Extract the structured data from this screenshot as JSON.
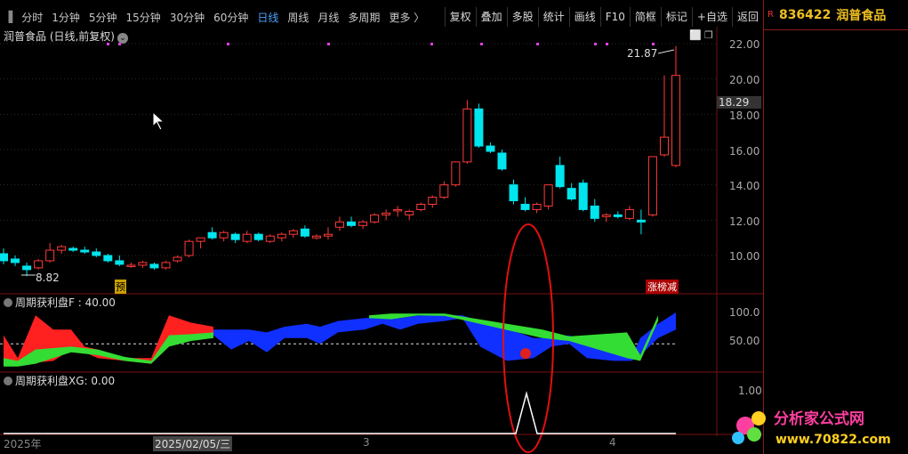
{
  "toolbar": {
    "periods": [
      "分时",
      "1分钟",
      "5分钟",
      "15分钟",
      "30分钟",
      "60分钟",
      "日线",
      "周线",
      "月线",
      "多周期",
      "更多 〉"
    ],
    "active_period": "日线",
    "buttons": [
      "复权",
      "叠加",
      "多股",
      "统计",
      "画线",
      "F10",
      "简框",
      "标记",
      "+自选",
      "返回"
    ]
  },
  "stock": {
    "title": "润普食品 (日线,前复权)",
    "code": "836422",
    "name": "润普食品"
  },
  "price_axis": [
    "22.00",
    "20.00",
    "18.00",
    "16.00",
    "14.00",
    "12.00",
    "10.00"
  ],
  "price_cursor": "18.29",
  "annotations": {
    "high": "21.87",
    "low": "8.82",
    "pre_tag": "预",
    "limit_tag": "涨榜减"
  },
  "indicator1": {
    "label": "周期获利盘F : 40.00",
    "axis": [
      "100.0",
      "50.00"
    ]
  },
  "indicator2": {
    "label": "周期获利盘XG: 0.00",
    "axis": [
      "1.00"
    ]
  },
  "time_axis": [
    "2025年",
    "2025/02/05/三",
    "3",
    "4"
  ],
  "colors": {
    "up": "#ff3a3a",
    "down": "#00e5ee",
    "red": "#ff2020",
    "green": "#33dd33",
    "blue": "#1030ff"
  },
  "chart_data": {
    "type": "candlestick",
    "ylim": [
      8,
      22.6
    ],
    "candles": [
      [
        10.1,
        10.4,
        9.5,
        9.7
      ],
      [
        9.8,
        10.0,
        9.4,
        9.6
      ],
      [
        9.4,
        9.6,
        8.82,
        9.2
      ],
      [
        9.3,
        9.8,
        9.2,
        9.7
      ],
      [
        9.7,
        10.7,
        9.6,
        10.3
      ],
      [
        10.3,
        10.6,
        10.1,
        10.5
      ],
      [
        10.4,
        10.5,
        10.2,
        10.3
      ],
      [
        10.3,
        10.5,
        10.1,
        10.2
      ],
      [
        10.2,
        10.4,
        9.9,
        10.0
      ],
      [
        10.0,
        10.1,
        9.6,
        9.7
      ],
      [
        9.7,
        10.0,
        9.4,
        9.5
      ],
      [
        9.4,
        9.6,
        9.3,
        9.45
      ],
      [
        9.45,
        9.7,
        9.3,
        9.6
      ],
      [
        9.5,
        9.6,
        9.2,
        9.3
      ],
      [
        9.3,
        9.7,
        9.2,
        9.6
      ],
      [
        9.7,
        10.0,
        9.6,
        9.9
      ],
      [
        10.0,
        10.9,
        9.9,
        10.8
      ],
      [
        10.8,
        11.0,
        10.4,
        11.0
      ],
      [
        11.3,
        11.6,
        10.9,
        11.0
      ],
      [
        11.0,
        11.4,
        10.8,
        11.3
      ],
      [
        11.2,
        11.3,
        10.7,
        10.9
      ],
      [
        10.8,
        11.4,
        10.7,
        11.2
      ],
      [
        11.2,
        11.3,
        10.8,
        10.9
      ],
      [
        10.8,
        11.2,
        10.7,
        11.1
      ],
      [
        11.0,
        11.3,
        10.8,
        11.2
      ],
      [
        11.2,
        11.5,
        11.0,
        11.4
      ],
      [
        11.5,
        11.7,
        11.0,
        11.1
      ],
      [
        11.0,
        11.2,
        10.9,
        11.1
      ],
      [
        11.1,
        11.6,
        10.9,
        11.2
      ],
      [
        11.6,
        12.2,
        11.4,
        11.9
      ],
      [
        11.9,
        12.2,
        11.6,
        11.7
      ],
      [
        11.7,
        12.0,
        11.5,
        11.9
      ],
      [
        11.9,
        12.4,
        11.8,
        12.3
      ],
      [
        12.3,
        12.6,
        12.0,
        12.4
      ],
      [
        12.6,
        12.8,
        12.2,
        12.6
      ],
      [
        12.3,
        12.6,
        12.0,
        12.5
      ],
      [
        12.6,
        13.0,
        12.5,
        12.9
      ],
      [
        12.9,
        13.4,
        12.7,
        13.3
      ],
      [
        13.3,
        14.2,
        13.2,
        14.0
      ],
      [
        14.0,
        15.2,
        13.9,
        15.3
      ],
      [
        15.3,
        18.8,
        15.2,
        18.3
      ],
      [
        18.3,
        18.6,
        16.1,
        16.2
      ],
      [
        16.2,
        16.4,
        15.8,
        15.9
      ],
      [
        15.8,
        16.0,
        14.8,
        14.9
      ],
      [
        14.0,
        14.3,
        12.9,
        13.1
      ],
      [
        12.9,
        13.3,
        12.5,
        12.6
      ],
      [
        12.6,
        13.0,
        12.4,
        12.9
      ],
      [
        12.8,
        14.0,
        12.6,
        14.0
      ],
      [
        15.1,
        15.6,
        13.8,
        13.9
      ],
      [
        13.8,
        14.1,
        13.1,
        13.2
      ],
      [
        14.1,
        14.3,
        12.5,
        12.6
      ],
      [
        12.8,
        13.2,
        11.9,
        12.1
      ],
      [
        12.2,
        12.4,
        11.9,
        12.3
      ],
      [
        12.3,
        12.5,
        12.1,
        12.2
      ],
      [
        12.1,
        12.8,
        12.0,
        12.6
      ],
      [
        12.0,
        12.6,
        11.2,
        11.9
      ],
      [
        12.3,
        15.6,
        12.2,
        15.6
      ],
      [
        15.7,
        20.2,
        15.6,
        16.7
      ],
      [
        15.1,
        21.87,
        15.0,
        20.2
      ]
    ]
  }
}
